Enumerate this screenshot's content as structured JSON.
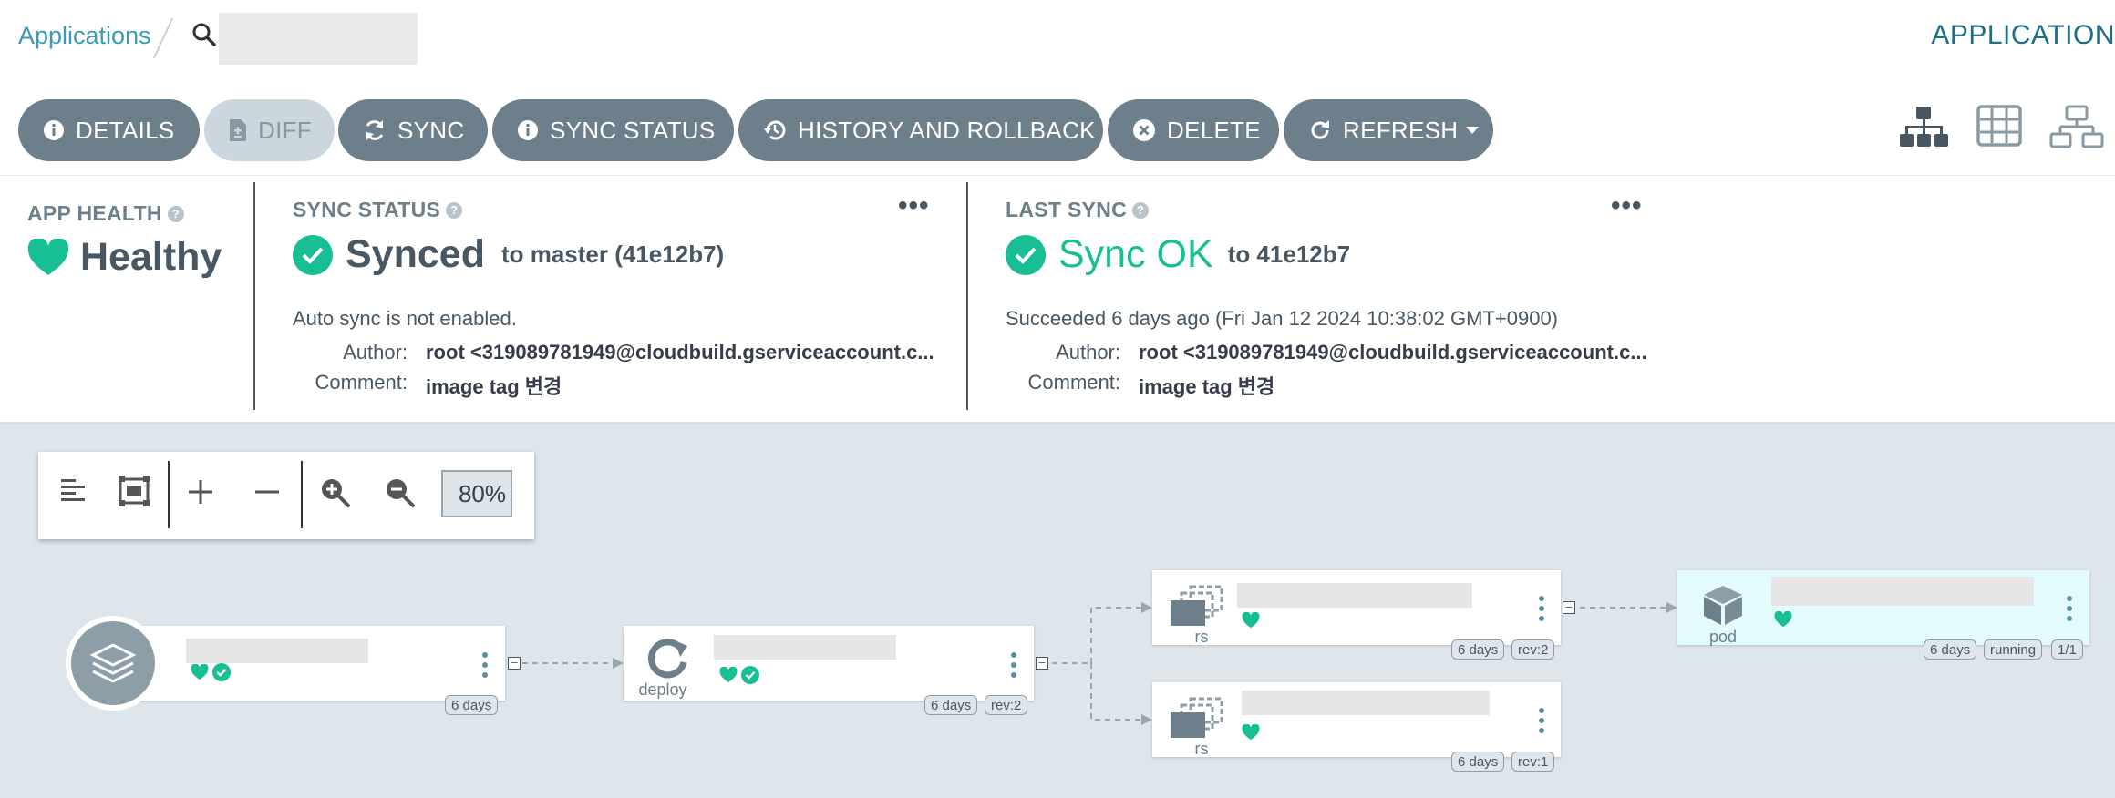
{
  "header": {
    "breadcrumb": "Applications",
    "search_value": "",
    "page_title": "APPLICATION"
  },
  "actions": {
    "details": "DETAILS",
    "diff": "DIFF",
    "sync": "SYNC",
    "sync_status": "SYNC STATUS",
    "history": "HISTORY AND ROLLBACK",
    "delete": "DELETE",
    "refresh": "REFRESH"
  },
  "view_icons": [
    "tree-view-icon",
    "grid-view-icon",
    "network-view-icon"
  ],
  "app_health": {
    "label": "APP HEALTH",
    "status": "Healthy"
  },
  "sync_status": {
    "label": "SYNC STATUS",
    "status": "Synced",
    "target": "to master (41e12b7)",
    "auto_sync": "Auto sync is not enabled.",
    "author_key": "Author:",
    "author": "root <319089781949@cloudbuild.gserviceaccount.c...",
    "comment_key": "Comment:",
    "comment": "image tag 변경"
  },
  "last_sync": {
    "label": "LAST SYNC",
    "status": "Sync OK",
    "target": "to 41e12b7",
    "detail": "Succeeded 6 days ago (Fri Jan 12 2024 10:38:02 GMT+0900)",
    "author_key": "Author:",
    "author": "root <319089781949@cloudbuild.gserviceaccount.c...",
    "comment_key": "Comment:",
    "comment": "image tag 변경"
  },
  "graph_toolbar": {
    "zoom": "80%"
  },
  "nodes": {
    "app": {
      "age": "6 days"
    },
    "deploy": {
      "kind": "deploy",
      "age": "6 days",
      "rev": "rev:2"
    },
    "rs1": {
      "kind": "rs",
      "age": "6 days",
      "rev": "rev:2"
    },
    "rs2": {
      "kind": "rs",
      "age": "6 days",
      "rev": "rev:1"
    },
    "pod": {
      "kind": "pod",
      "age": "6 days",
      "status": "running",
      "ready": "1/1"
    }
  },
  "colors": {
    "healthy": "#18be94",
    "synced": "#18be94",
    "button": "#6d7f8b",
    "link": "#3a9bb4"
  }
}
